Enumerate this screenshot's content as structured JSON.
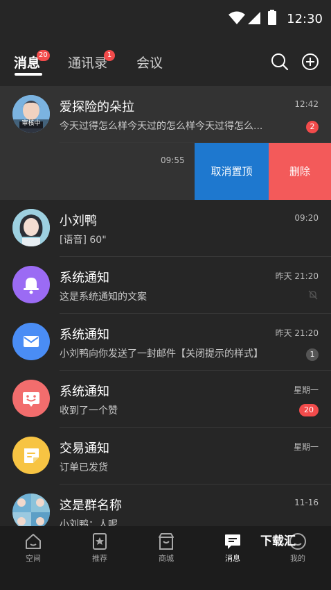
{
  "status_bar": {
    "time": "12:30"
  },
  "top_nav": {
    "tabs": [
      {
        "label": "消息",
        "badge": "20"
      },
      {
        "label": "通讯录",
        "badge": "1"
      },
      {
        "label": "会议"
      }
    ]
  },
  "conversations": [
    {
      "name": "爱探险的朵拉",
      "preview": "今天过得怎么样今天过的怎么样今天过得怎么...",
      "time": "12:42",
      "unread": "2",
      "avatar_tag": "审核中"
    },
    {
      "time": "09:55",
      "actions": {
        "unpin": "取消置顶",
        "delete": "删除"
      }
    },
    {
      "name": "小刘鸭",
      "preview": "[语音] 60\"",
      "time": "09:20"
    },
    {
      "name": "系统通知",
      "preview": "这是系统通知的文案",
      "time": "昨天 21:20",
      "icon": "bell-icon",
      "color": "#9b6bf4"
    },
    {
      "name": "系统通知",
      "preview": "小刘鸭向你发送了一封邮件【关闭提示的样式】",
      "time": "昨天 21:20",
      "unread": "1",
      "icon": "mail-icon",
      "color": "#4a8df5"
    },
    {
      "name": "系统通知",
      "preview": "收到了一个赞",
      "time": "星期一",
      "unread": "20",
      "icon": "smile-message-icon",
      "color": "#f26d6d"
    },
    {
      "name": "交易通知",
      "preview": "订单已发货",
      "time": "星期一",
      "icon": "note-icon",
      "color": "#f7c443"
    },
    {
      "name": "这是群名称",
      "preview": "小刘鸭：人呢",
      "time": "11-16"
    }
  ],
  "bottom_nav": [
    {
      "label": "空间",
      "icon": "home-icon"
    },
    {
      "label": "推荐",
      "icon": "star-bookmark-icon"
    },
    {
      "label": "商城",
      "icon": "shop-icon"
    },
    {
      "label": "消息",
      "icon": "message-icon"
    },
    {
      "label": "我的",
      "icon": "profile-icon"
    }
  ],
  "watermark": "下载汇"
}
